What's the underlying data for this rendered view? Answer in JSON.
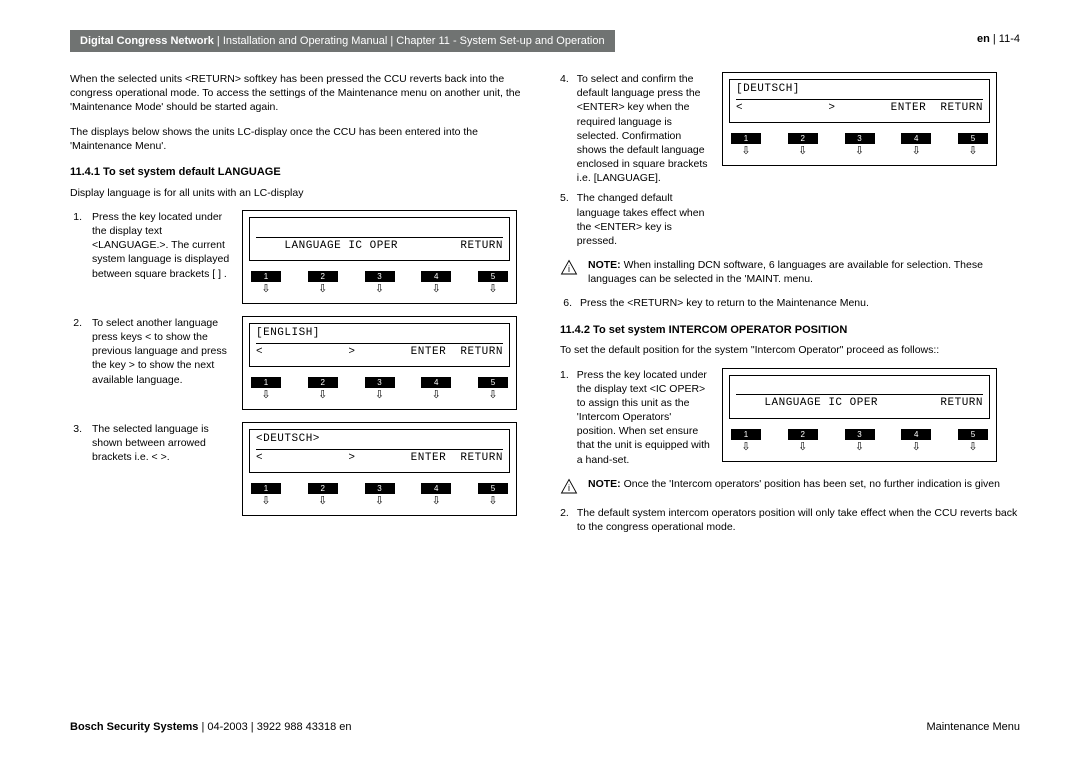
{
  "header": {
    "title_bold": "Digital Congress Network",
    "title_rest": " | Installation and Operating Manual | Chapter 11 - System Set-up and Operation",
    "lang": "en",
    "page": " | 11-4"
  },
  "left": {
    "intro1": "When the selected units <RETURN> softkey has been pressed the CCU reverts back into the congress operational mode. To access the settings of the Maintenance menu on another unit, the 'Maintenance Mode' should be started again.",
    "intro2": "The displays below shows the units LC-display once the CCU has been entered into the 'Maintenance Menu'.",
    "sec1_num": "11.4.1",
    "sec1_title": "  To set system default LANGUAGE",
    "sub1": "Display language is for all units with an LC-display",
    "step1_num": "1.",
    "step1_txt": "Press the key located under the display text <LANGUAGE.>. The current system language is displayed between square brackets [  ] .",
    "step2_num": "2.",
    "step2_txt": "To select another language press keys < to show the previous language and press the key > to show the next  available language.",
    "step3_num": "3.",
    "step3_txt": "The selected language is shown between arrowed brackets i.e. < >."
  },
  "right": {
    "step4_num": "4.",
    "step4_txt": "To select and confirm the default language press the <ENTER> key when the required language is selected.  Confirmation shows the default language enclosed in square brackets  i.e. [LANGUAGE].",
    "step5_num": "5.",
    "step5_txt": "The changed default language takes effect when the <ENTER> key is pressed.",
    "note1_b": "NOTE:",
    "note1_t": "  When installing DCN software, 6 languages are available for selection. These languages can be selected in the 'MAINT. menu.",
    "step6_num": "6.",
    "step6_txt": "Press the <RETURN> key to return to the Maintenance Menu.",
    "sec2_num": "11.4.2",
    "sec2_title": "  To set system INTERCOM OPERATOR POSITION",
    "sec2_intro": "To set the default position for the system \"Intercom Operator\" proceed as follows::",
    "r_step1_num": "1.",
    "r_step1_txt": "Press the key located under the display text <IC OPER> to assign this unit as the 'Intercom Operators' position. When set ensure that the unit is equipped with a hand-set.",
    "note2_b": "NOTE:",
    "note2_t": " Once the 'Intercom operators' position has been set, no further indication is given",
    "r_step2_num": "2.",
    "r_step2_txt": "The default system intercom operators position will only take effect  when the CCU  reverts back to the congress operational mode."
  },
  "lcd": {
    "l1_top": " ",
    "l1_left": "    LANGUAGE IC OPER",
    "l1_right": "RETURN",
    "l2_top": "[ENGLISH]",
    "l2_left": "<            >",
    "l2_right": "ENTER  RETURN",
    "l3_top": "<DEUTSCH>",
    "l3_left": "<            >",
    "l3_right": "ENTER  RETURN",
    "r1_top": "[DEUTSCH]",
    "r1_left": "<            >",
    "r1_right": "ENTER  RETURN",
    "r2_top": " ",
    "r2_left": "    LANGUAGE IC OPER",
    "r2_right": "RETURN",
    "btn1": "1",
    "btn2": "2",
    "btn3": "3",
    "btn4": "4",
    "btn5": "5"
  },
  "footer": {
    "left_b": "Bosch Security Systems",
    "left_r": " | 04-2003 | 3922 988 43318 en",
    "right": "Maintenance Menu"
  }
}
